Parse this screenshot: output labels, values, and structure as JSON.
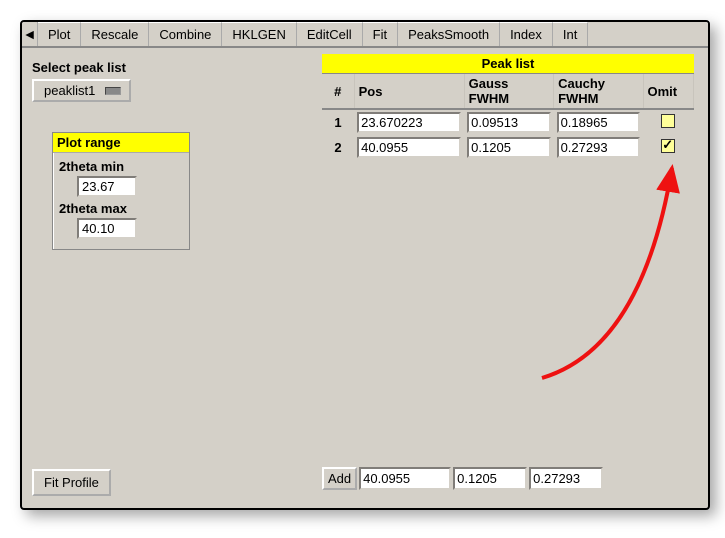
{
  "tabs": [
    "Plot",
    "Rescale",
    "Combine",
    "HKLGEN",
    "EditCell",
    "Fit",
    "PeaksSmooth",
    "Index",
    "Int"
  ],
  "left": {
    "select_label": "Select peak list",
    "dropdown_value": "peaklist1",
    "plot_range": {
      "title": "Plot range",
      "min_label": "2theta min",
      "min_value": "23.67",
      "max_label": "2theta max",
      "max_value": "40.10"
    },
    "fit_button": "Fit Profile"
  },
  "peaklist": {
    "title": "Peak list",
    "headers": {
      "num": "#",
      "pos": "Pos",
      "gauss": "Gauss FWHM",
      "cauchy": "Cauchy FWHM",
      "omit": "Omit"
    },
    "rows": [
      {
        "num": "1",
        "pos": "23.670223",
        "gauss": "0.09513",
        "cauchy": "0.18965",
        "omit": false
      },
      {
        "num": "2",
        "pos": "40.0955",
        "gauss": "0.1205",
        "cauchy": "0.27293",
        "omit": true
      }
    ],
    "add": {
      "label": "Add",
      "pos": "40.0955",
      "gauss": "0.1205",
      "cauchy": "0.27293"
    }
  }
}
